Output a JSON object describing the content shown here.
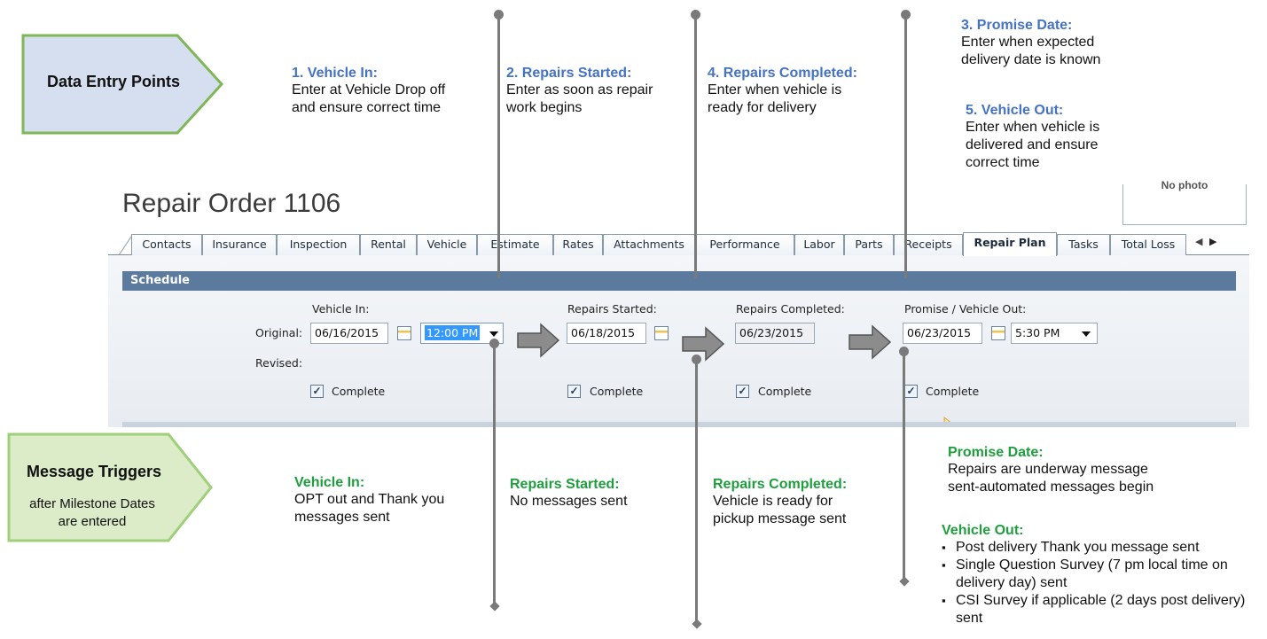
{
  "callouts": {
    "data_entry": {
      "label": "Data Entry Points"
    },
    "message_triggers": {
      "title": "Message Triggers",
      "subtitle_line1": "after Milestone Dates",
      "subtitle_line2": "are entered"
    }
  },
  "entry_points": {
    "vehicle_in": {
      "heading": "1.  Vehicle In:",
      "line1": "Enter at Vehicle Drop off",
      "line2": "and ensure correct time"
    },
    "repairs_started": {
      "heading": "2. Repairs Started:",
      "line1": "Enter as soon as repair",
      "line2": "work begins"
    },
    "repairs_completed": {
      "heading": "4. Repairs Completed:",
      "line1": "Enter when vehicle is",
      "line2": "ready for delivery"
    },
    "promise_date": {
      "heading": "3. Promise Date:",
      "line1": "Enter when expected",
      "line2": "delivery date is known"
    },
    "vehicle_out": {
      "heading": "5. Vehicle Out:",
      "line1": "Enter when vehicle is",
      "line2": "delivered and ensure",
      "line3": "correct time"
    }
  },
  "app": {
    "title": "Repair Order 1106",
    "photo_label": "No photo",
    "tabs": [
      "Contacts",
      "Insurance",
      "Inspection",
      "Rental",
      "Vehicle",
      "Estimate",
      "Rates",
      "Attachments",
      "Performance",
      "Labor",
      "Parts",
      "Receipts",
      "Repair Plan",
      "Tasks",
      "Total Loss"
    ],
    "active_tab": "Repair Plan",
    "tab_scroll_left": "◀",
    "tab_scroll_right": "▶",
    "section_title": "Schedule",
    "row_original": "Original:",
    "row_revised": "Revised:",
    "milestones": {
      "vehicle_in": {
        "label": "Vehicle In:",
        "date": "06/16/2015",
        "time": "12:00 PM",
        "complete": "Complete"
      },
      "repairs_started": {
        "label": "Repairs Started:",
        "date": "06/18/2015",
        "complete": "Complete"
      },
      "repairs_completed": {
        "label": "Repairs Completed:",
        "date": "06/23/2015",
        "complete": "Complete"
      },
      "promise_vehicle_out": {
        "label": "Promise / Vehicle Out:",
        "date": "06/23/2015",
        "time": "5:30 PM",
        "complete": "Complete"
      }
    },
    "checkmark": "✓"
  },
  "triggers": {
    "vehicle_in": {
      "heading": "Vehicle In:",
      "line1": "OPT out and Thank you",
      "line2": "messages sent"
    },
    "repairs_started": {
      "heading": "Repairs Started:",
      "line1": "No messages sent"
    },
    "repairs_completed": {
      "heading": "Repairs Completed:",
      "line1": "Vehicle is ready for",
      "line2": "pickup message sent"
    },
    "promise_date": {
      "heading": "Promise Date:",
      "line1": "Repairs are underway message",
      "line2": "sent-automated messages begin"
    },
    "vehicle_out": {
      "heading": "Vehicle Out:",
      "bullets": [
        "Post delivery Thank you message sent",
        "Single Question Survey (7 pm local time on delivery day) sent",
        "CSI Survey if applicable (2 days post delivery) sent"
      ]
    }
  },
  "colors": {
    "accent_blue": "#4472c4",
    "accent_green": "#1e9e3c",
    "callout_blue_fill": "#d6dff0",
    "callout_green_fill": "#dcecc8",
    "callout_border": "#7fb657",
    "schedule_bar": "#5b7a9d"
  }
}
